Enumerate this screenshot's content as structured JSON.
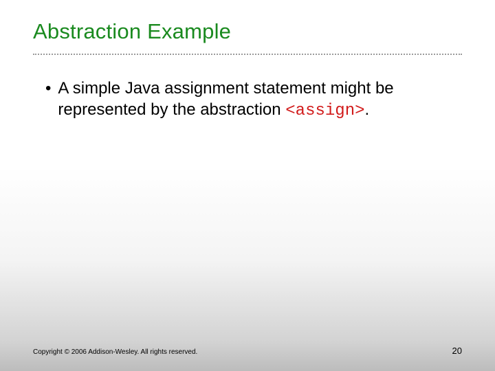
{
  "slide": {
    "title": "Abstraction Example",
    "bullet": {
      "marker": "•",
      "text_before": "A simple Java assignment statement might be represented by the abstraction ",
      "code": "<assign>",
      "text_after": "."
    },
    "footer": {
      "copyright": "Copyright © 2006 Addison-Wesley. All rights reserved.",
      "page_number": "20"
    }
  }
}
